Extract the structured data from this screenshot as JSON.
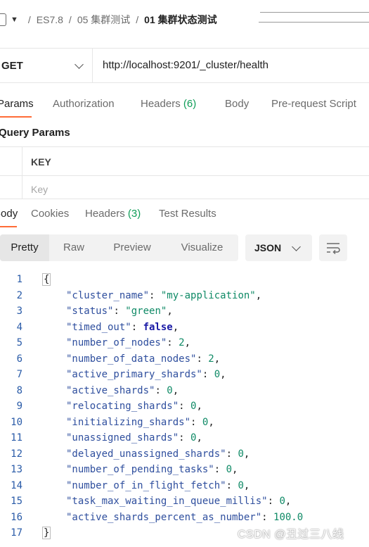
{
  "breadcrumb": {
    "items": [
      "ES7.8",
      "05 集群测试",
      "01 集群状态测试"
    ],
    "separator": "/"
  },
  "request": {
    "method": "GET",
    "url": "http://localhost:9201/_cluster/health"
  },
  "request_tabs": [
    {
      "label": "Params",
      "count": ""
    },
    {
      "label": "Authorization",
      "count": ""
    },
    {
      "label": "Headers",
      "count": "(6)"
    },
    {
      "label": "Body",
      "count": ""
    },
    {
      "label": "Pre-request Script",
      "count": ""
    }
  ],
  "query_params": {
    "title": "Query Params",
    "header_key": "KEY",
    "key_placeholder": "Key"
  },
  "response_tabs": [
    {
      "label": "Body",
      "count": ""
    },
    {
      "label": "Cookies",
      "count": ""
    },
    {
      "label": "Headers",
      "count": "(3)"
    },
    {
      "label": "Test Results",
      "count": ""
    }
  ],
  "view_modes": [
    "Pretty",
    "Raw",
    "Preview",
    "Visualize"
  ],
  "format": "JSON",
  "code_lines": [
    {
      "n": "1",
      "open": "{"
    },
    {
      "n": "2",
      "key": "cluster_name",
      "val": "\"my-application\"",
      "vt": "s"
    },
    {
      "n": "3",
      "key": "status",
      "val": "\"green\"",
      "vt": "s"
    },
    {
      "n": "4",
      "key": "timed_out",
      "val": "false",
      "vt": "b"
    },
    {
      "n": "5",
      "key": "number_of_nodes",
      "val": "2",
      "vt": "n"
    },
    {
      "n": "6",
      "key": "number_of_data_nodes",
      "val": "2",
      "vt": "n"
    },
    {
      "n": "7",
      "key": "active_primary_shards",
      "val": "0",
      "vt": "n"
    },
    {
      "n": "8",
      "key": "active_shards",
      "val": "0",
      "vt": "n"
    },
    {
      "n": "9",
      "key": "relocating_shards",
      "val": "0",
      "vt": "n"
    },
    {
      "n": "10",
      "key": "initializing_shards",
      "val": "0",
      "vt": "n"
    },
    {
      "n": "11",
      "key": "unassigned_shards",
      "val": "0",
      "vt": "n"
    },
    {
      "n": "12",
      "key": "delayed_unassigned_shards",
      "val": "0",
      "vt": "n"
    },
    {
      "n": "13",
      "key": "number_of_pending_tasks",
      "val": "0",
      "vt": "n"
    },
    {
      "n": "14",
      "key": "number_of_in_flight_fetch",
      "val": "0",
      "vt": "n"
    },
    {
      "n": "15",
      "key": "task_max_waiting_in_queue_millis",
      "val": "0",
      "vt": "n"
    },
    {
      "n": "16",
      "key": "active_shards_percent_as_number",
      "val": "100.0",
      "vt": "n",
      "last": true
    },
    {
      "n": "17",
      "open": "}"
    }
  ],
  "watermark": "CSDN @丑过三八线",
  "colors": {
    "accent": "#ff6c37",
    "count": "#0f9d58",
    "line_number": "#2a5ba8"
  }
}
